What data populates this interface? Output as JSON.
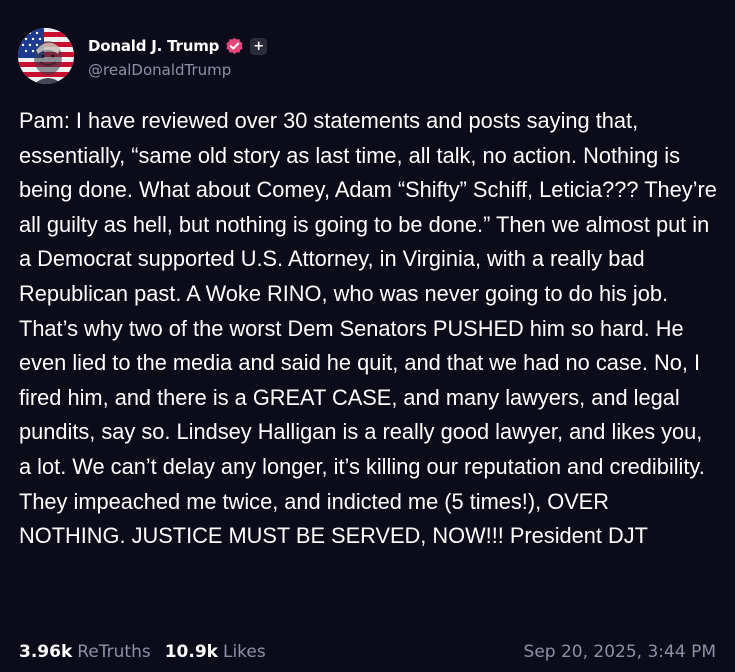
{
  "author": {
    "display_name": "Donald J. Trump",
    "handle": "@realDonaldTrump",
    "plus_label": "+"
  },
  "post": {
    "text": "Pam: I have reviewed over 30 statements and posts saying that, essentially, “same old story as last time, all talk, no action. Nothing is being done. What about Comey, Adam “Shifty” Schiff, Leticia??? They’re all guilty as hell, but nothing is going to be done.” Then we almost put in a Democrat supported U.S. Attorney, in Virginia, with a really bad Republican past. A Woke RINO, who was never going to do his job. That’s why two of the worst Dem Senators PUSHED him so hard. He even lied to the media and said he quit, and that we had no case. No, I fired him, and there is a GREAT CASE, and many lawyers, and legal pundits, say so. Lindsey Halligan is a really good lawyer, and likes you, a lot. We can’t delay any longer, it’s killing our reputation and credibility. They impeached me twice, and indicted me (5 times!), OVER NOTHING. JUSTICE MUST BE SERVED, NOW!!! President DJT"
  },
  "stats": {
    "retruths_count": "3.96k",
    "retruths_label": "ReTruths",
    "likes_count": "10.9k",
    "likes_label": "Likes",
    "timestamp": "Sep 20, 2025, 3:44 PM"
  },
  "colors": {
    "background": "#0b0b1a",
    "text": "#ffffff",
    "muted": "#8f8fa8",
    "verified": "#e5467a"
  },
  "icons": {
    "verified": "verified-badge-icon",
    "plus": "plus-badge-icon"
  }
}
